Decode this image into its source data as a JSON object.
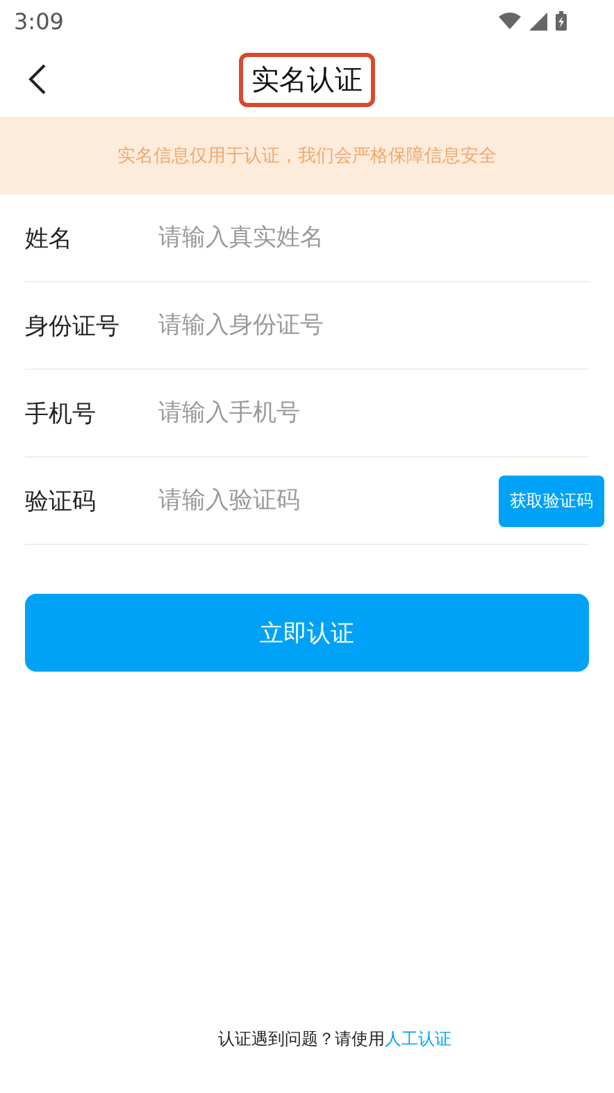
{
  "status_bar": {
    "time": "3:09"
  },
  "header": {
    "title": "实名认证",
    "highlighted": true
  },
  "notice": "实名信息仅用于认证，我们会严格保障信息安全",
  "fields": [
    {
      "label": "姓名",
      "placeholder": "请输入真实姓名"
    },
    {
      "label": "身份证号",
      "placeholder": "请输入身份证号"
    },
    {
      "label": "手机号",
      "placeholder": "请输入手机号"
    },
    {
      "label": "验证码",
      "placeholder": "请输入验证码",
      "action": "获取验证码"
    }
  ],
  "submit": "立即认证",
  "footer": {
    "text": "认证遇到问题？请使用",
    "link": "人工认证"
  }
}
